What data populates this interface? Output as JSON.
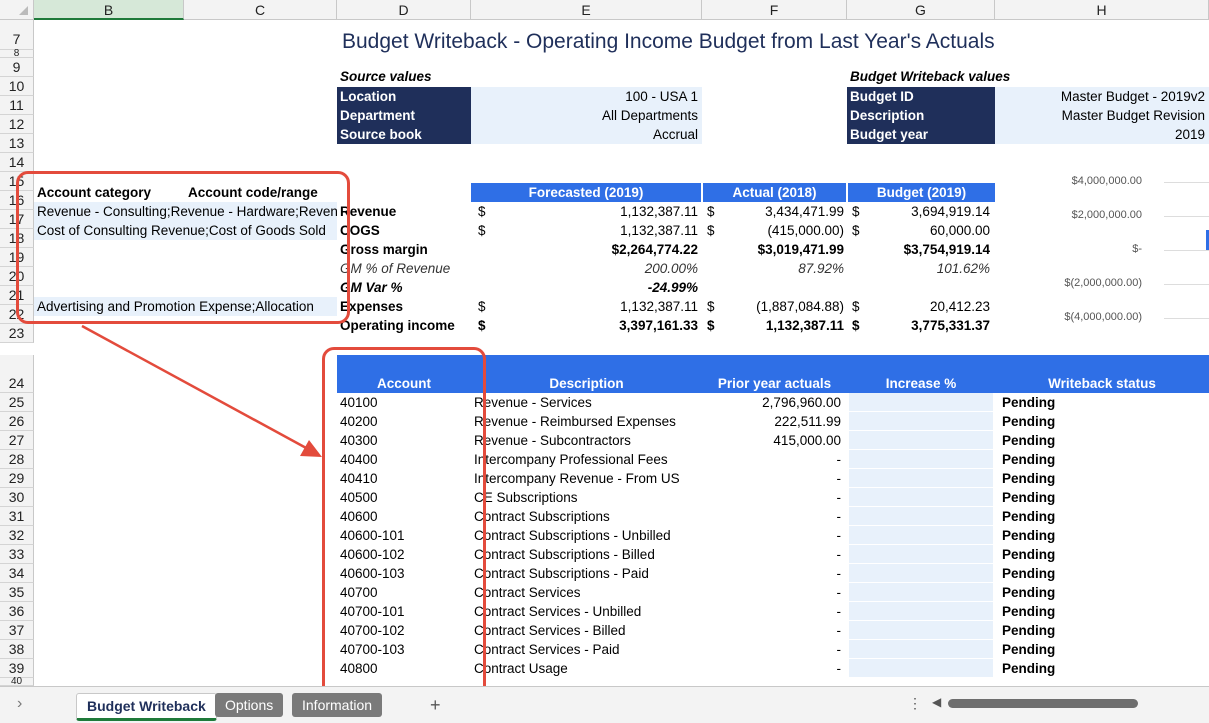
{
  "columns": [
    "B",
    "C",
    "D",
    "E",
    "F",
    "G",
    "H"
  ],
  "rows": [
    "7",
    "8",
    "9",
    "10",
    "11",
    "12",
    "13",
    "14",
    "15",
    "16",
    "17",
    "18",
    "19",
    "20",
    "21",
    "22",
    "23",
    "24",
    "25",
    "26",
    "27",
    "28",
    "29",
    "30",
    "31",
    "32",
    "33",
    "34",
    "35",
    "36",
    "37",
    "38",
    "39",
    "40"
  ],
  "title": "Budget Writeback - Operating Income Budget from Last Year's Actuals",
  "source": {
    "heading": "Source values",
    "items": [
      {
        "label": "Location",
        "value": "100 - USA 1"
      },
      {
        "label": "Department",
        "value": "All Departments"
      },
      {
        "label": "Source book",
        "value": "Accrual"
      }
    ]
  },
  "writeback": {
    "heading": "Budget Writeback values",
    "items": [
      {
        "label": "Budget ID",
        "value": "Master Budget - 2019v2"
      },
      {
        "label": "Description",
        "value": "Master Budget Revision"
      },
      {
        "label": "Budget year",
        "value": "2019"
      }
    ]
  },
  "account_map": {
    "headers": [
      "Account category",
      "Account code/range"
    ],
    "rows": [
      "Revenue - Consulting;Revenue - Hardware;Revenue",
      "Cost of Consulting Revenue;Cost of Goods Sold",
      "Advertising and Promotion Expense;Allocation"
    ]
  },
  "summary": {
    "headers": [
      "Forecasted (2019)",
      "Actual (2018)",
      "Budget (2019)"
    ],
    "rows": [
      {
        "label": "Revenue",
        "cur1": "$",
        "forecast": "1,132,387.11",
        "cur2": "$",
        "actual": "3,434,471.99",
        "cur3": "$",
        "budget": "3,694,919.14",
        "style": "bold"
      },
      {
        "label": "COGS",
        "cur1": "$",
        "forecast": "1,132,387.11",
        "cur2": "$",
        "actual": "(415,000.00)",
        "cur3": "$",
        "budget": "60,000.00",
        "style": "bold"
      },
      {
        "label": "Gross margin",
        "cur1": "",
        "forecast": "$2,264,774.22",
        "cur2": "",
        "actual": "$3,019,471.99",
        "cur3": "",
        "budget": "$3,754,919.14",
        "style": "bold-all"
      },
      {
        "label": "GM % of Revenue",
        "cur1": "",
        "forecast": "200.00%",
        "cur2": "",
        "actual": "87.92%",
        "cur3": "",
        "budget": "101.62%",
        "style": "italic"
      },
      {
        "label": "GM Var %",
        "cur1": "",
        "forecast": "-24.99%",
        "cur2": "",
        "actual": "",
        "cur3": "",
        "budget": "",
        "style": "bold-italic"
      },
      {
        "label": "Expenses",
        "cur1": "$",
        "forecast": "1,132,387.11",
        "cur2": "$",
        "actual": "(1,887,084.88)",
        "cur3": "$",
        "budget": "20,412.23",
        "style": "bold"
      },
      {
        "label": "Operating income",
        "cur1": "$",
        "forecast": "3,397,161.33",
        "cur2": "$",
        "actual": "1,132,387.11",
        "cur3": "$",
        "budget": "3,775,331.37",
        "style": "bold-all"
      }
    ]
  },
  "chart_axis": [
    "$4,000,000.00",
    "$2,000,000.00",
    "$-",
    "$(2,000,000.00)",
    "$(4,000,000.00)"
  ],
  "detail": {
    "headers": [
      "Account",
      "Description",
      "Prior year actuals",
      "Increase %",
      "Writeback status"
    ],
    "rows": [
      {
        "account": "40100",
        "description": "Revenue - Services",
        "prior": "2,796,960.00",
        "status": "Pending"
      },
      {
        "account": "40200",
        "description": "Revenue - Reimbursed Expenses",
        "prior": "222,511.99",
        "status": "Pending"
      },
      {
        "account": "40300",
        "description": "Revenue - Subcontractors",
        "prior": "415,000.00",
        "status": "Pending"
      },
      {
        "account": "40400",
        "description": "Intercompany Professional Fees",
        "prior": "-",
        "status": "Pending"
      },
      {
        "account": "40410",
        "description": "Intercompany Revenue - From US",
        "prior": "-",
        "status": "Pending"
      },
      {
        "account": "40500",
        "description": "CE Subscriptions",
        "prior": "-",
        "status": "Pending"
      },
      {
        "account": "40600",
        "description": "Contract Subscriptions",
        "prior": "-",
        "status": "Pending"
      },
      {
        "account": "40600-101",
        "description": "Contract Subscriptions - Unbilled",
        "prior": "-",
        "status": "Pending"
      },
      {
        "account": "40600-102",
        "description": "Contract Subscriptions - Billed",
        "prior": "-",
        "status": "Pending"
      },
      {
        "account": "40600-103",
        "description": "Contract Subscriptions - Paid",
        "prior": "-",
        "status": "Pending"
      },
      {
        "account": "40700",
        "description": "Contract Services",
        "prior": "-",
        "status": "Pending"
      },
      {
        "account": "40700-101",
        "description": "Contract Services - Unbilled",
        "prior": "-",
        "status": "Pending"
      },
      {
        "account": "40700-102",
        "description": "Contract Services - Billed",
        "prior": "-",
        "status": "Pending"
      },
      {
        "account": "40700-103",
        "description": "Contract Services - Paid",
        "prior": "-",
        "status": "Pending"
      },
      {
        "account": "40800",
        "description": "Contract Usage",
        "prior": "-",
        "status": "Pending"
      }
    ]
  },
  "tabs": {
    "active": "Budget Writeback",
    "others": [
      "Options",
      "Information"
    ],
    "add": "+"
  },
  "colors": {
    "navy": "#1f2f5a",
    "blue_header": "#2f6fe6",
    "light_blue": "#e8f1fb",
    "annotation_red": "#e34b3c",
    "tab_active": "#1f7a3a"
  }
}
